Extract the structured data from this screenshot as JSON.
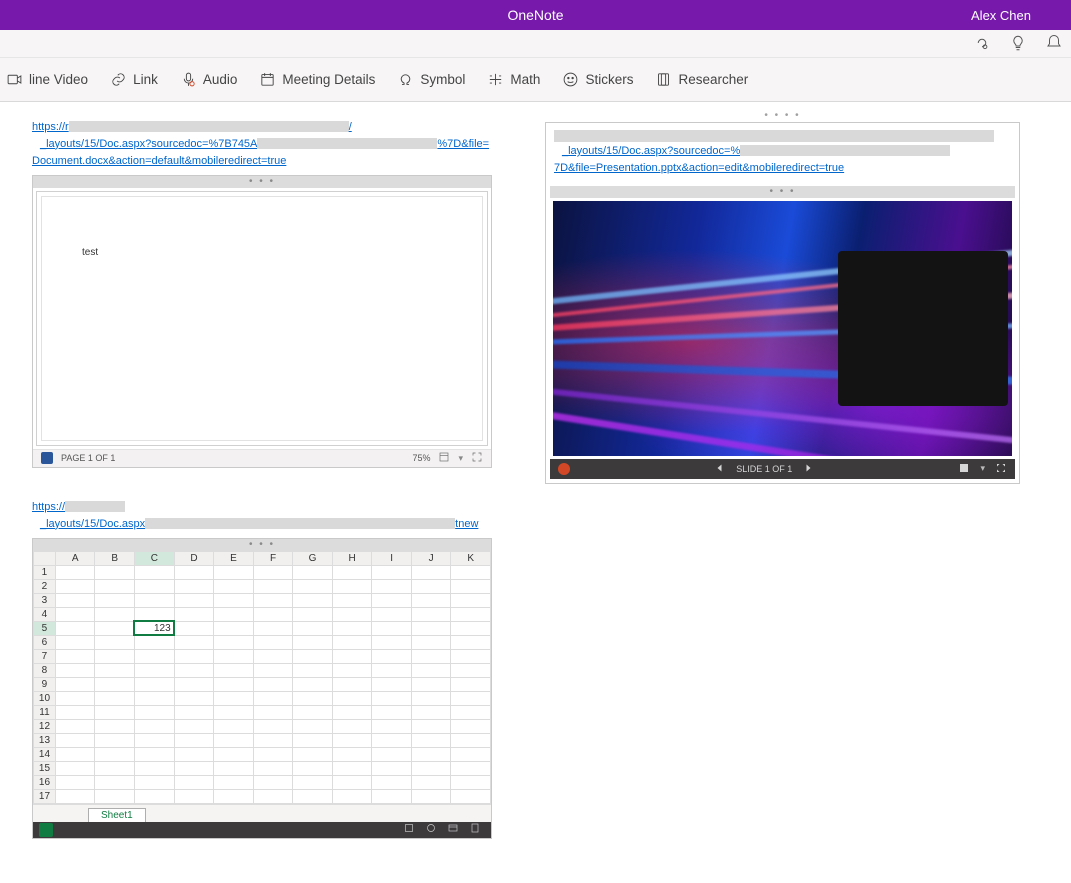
{
  "titlebar": {
    "app": "OneNote",
    "user": "Alex  Chen"
  },
  "toolbar": {
    "video": "line Video",
    "link": "Link",
    "audio": "Audio",
    "meeting": "Meeting Details",
    "symbol": "Symbol",
    "math": "Math",
    "stickers": "Stickers",
    "researcher": "Researcher"
  },
  "word": {
    "url_pre": "https://r",
    "url_mid1": "_layouts/15/Doc.aspx?sourcedoc=%7B745A",
    "url_mid2": "%7D&file=Document.docx&action=default&mobileredirect=true",
    "body_text": "test",
    "page_status": "PAGE 1 OF 1",
    "zoom": "75%"
  },
  "ppt": {
    "url_line1": "  _layouts/15/Doc.aspx?sourcedoc=%",
    "url_line2": "7D&file=Presentation.pptx&action=edit&mobileredirect=true",
    "slide_status": "SLIDE 1 OF 1"
  },
  "excel": {
    "url_pre": "https://",
    "url_mid": "_layouts/15/Doc.aspx",
    "url_end": "tnew",
    "columns": [
      "A",
      "B",
      "C",
      "D",
      "E",
      "F",
      "G",
      "H",
      "I",
      "J",
      "K"
    ],
    "rows": 17,
    "selected": {
      "row": 5,
      "col": "C",
      "value": "123"
    },
    "sheet": "Sheet1"
  }
}
